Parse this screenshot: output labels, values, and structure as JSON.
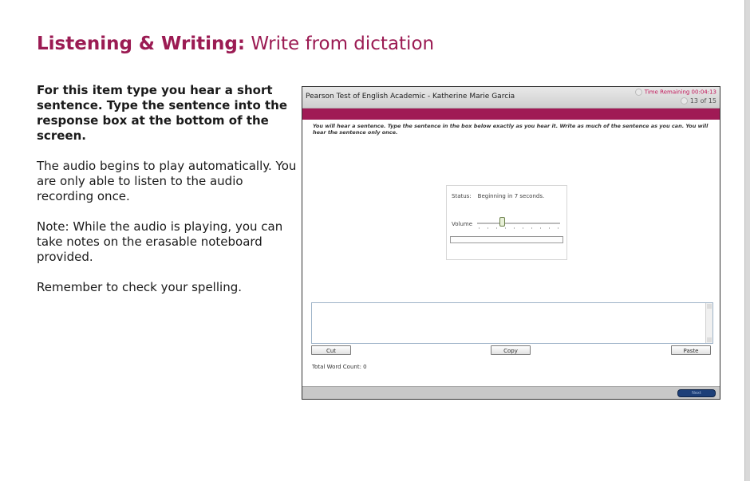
{
  "slide": {
    "title_bold": "Listening & Writing:",
    "title_light": "Write from dictation"
  },
  "instructions": [
    "For this item type you hear a short sentence. Type the sentence into the response box at the bottom of the screen.",
    "The audio begins to play automatically. You are only able to listen to the audio recording once.",
    "Note: While the audio is playing, you can take notes on the erasable noteboard provided.",
    "Remember to check your spelling."
  ],
  "test_screen": {
    "title": "Pearson Test of English Academic - Katherine Marie Garcia",
    "timer": "Time Remaining 00:04:13",
    "item_counter": "13 of 15",
    "prompt": "You will hear a sentence. Type the sentence in the box below exactly as you hear it. Write as much of the sentence as you can. You will hear the sentence only once.",
    "player": {
      "status_label": "Status:",
      "status_value": "Beginning in 7 seconds.",
      "volume_label": "Volume",
      "volume_level": 0.3,
      "progress": 0
    },
    "response": {
      "value": ""
    },
    "buttons": {
      "cut": "Cut",
      "copy": "Copy",
      "paste": "Paste",
      "next": "Next"
    },
    "word_count": "Total Word Count: 0"
  },
  "colors": {
    "accent": "#a01a55",
    "title": "#9b1b53",
    "next_button": "#1d3f78"
  }
}
